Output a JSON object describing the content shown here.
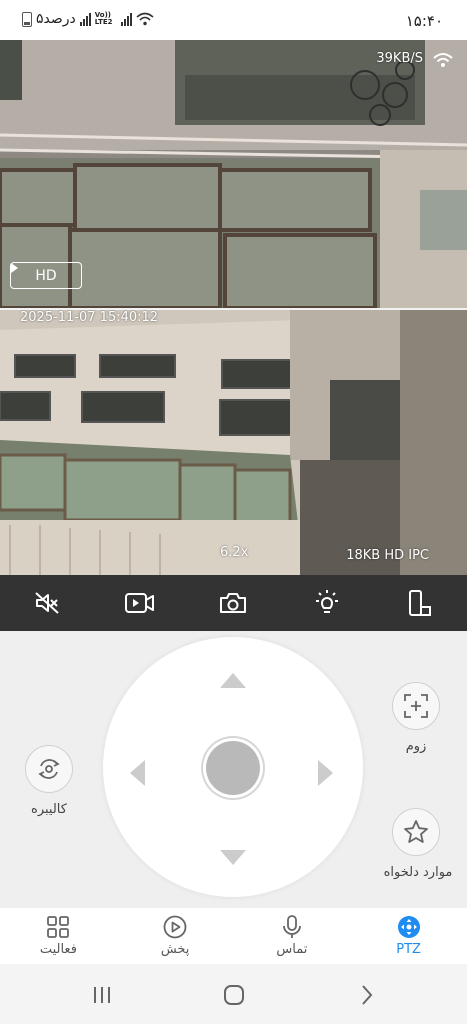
{
  "status_bar": {
    "time": "۱۵:۴۰",
    "battery_text": "۵درصد",
    "network_label": "Vo)) LTE2",
    "icons": [
      "battery-icon",
      "signal-icon",
      "signal-icon",
      "wifi-icon"
    ]
  },
  "feed1": {
    "bitrate": "39KB/S",
    "quality_button": "HD"
  },
  "feed2": {
    "timestamp": "2025-11-07 15:40:12",
    "zoom": "6.2x",
    "info": "18KB HD IPC"
  },
  "toolbar": {
    "icons": [
      "mute-icon",
      "record-video-icon",
      "camera-icon",
      "light-bulb-icon",
      "screen-rotate-icon"
    ]
  },
  "ptz": {
    "calibrate_label": "کالیبره",
    "zoom_label": "زوم",
    "favorites_label": "موارد دلخواه"
  },
  "bottom_nav": {
    "items": [
      {
        "label": "PTZ",
        "icon": "ptz-icon",
        "active": true
      },
      {
        "label": "تماس",
        "icon": "microphone-icon",
        "active": false
      },
      {
        "label": "پخش",
        "icon": "play-icon",
        "active": false
      },
      {
        "label": "فعالیت",
        "icon": "grid-icon",
        "active": false
      }
    ]
  },
  "colors": {
    "accent": "#1e8cf0",
    "toolbar_bg": "#333333",
    "panel_bg": "#efefef"
  }
}
